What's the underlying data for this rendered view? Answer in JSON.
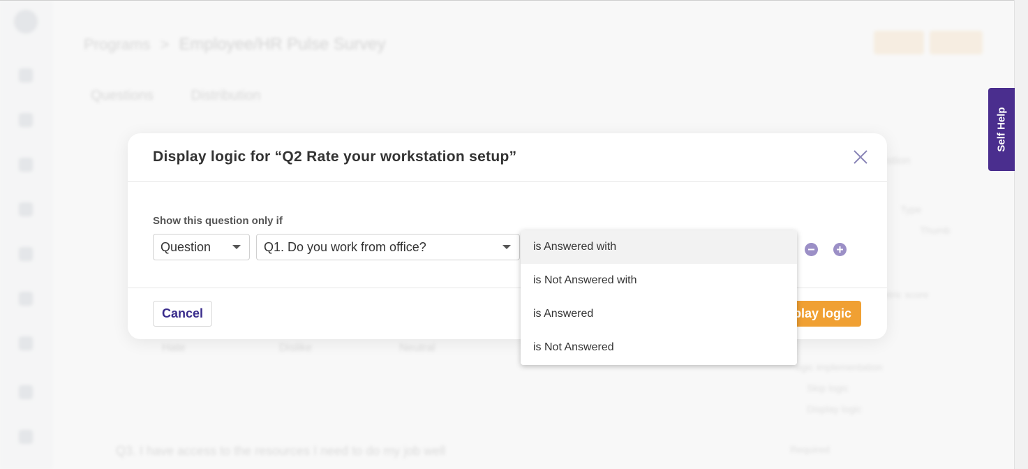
{
  "app": {
    "breadcrumb": {
      "parent": "Programs",
      "separator": ">",
      "current": "Employee/HR Pulse Survey"
    },
    "tabs": [
      "Questions",
      "Distribution"
    ],
    "background_text": {
      "q3": "Q3.  I have access to the resources I need to do my job well",
      "scale_labels": [
        "Hate",
        "Dislike",
        "Neutral"
      ],
      "right_panel": {
        "question": "estion",
        "type": "Type",
        "type_value": "Thumb",
        "metric": "etric score",
        "logic_impl": "ogic implementation",
        "skip_logic": "Skip logic",
        "display_logic": "Display logic",
        "required": "Required"
      }
    }
  },
  "self_help": {
    "label": "Self Help",
    "color": "#4a2e8e"
  },
  "modal": {
    "title": "Display logic for “Q2 Rate your workstation setup”",
    "close_icon": "close-icon",
    "condition_label": "Show this question only if",
    "type_select": {
      "value": "Question"
    },
    "question_select": {
      "value": "Q1. Do you work from office?"
    },
    "remove_icon": "minus-circle-icon",
    "add_icon": "plus-circle-icon",
    "cancel_label": "Cancel",
    "primary_label_visible": "splay logic",
    "primary_color": "#f0a033",
    "accent_color": "#3a2d8c"
  },
  "operator_dropdown": {
    "options": [
      "is Answered with",
      "is Not Answered with",
      "is Answered",
      "is Not Answered"
    ],
    "highlighted_index": 0
  }
}
